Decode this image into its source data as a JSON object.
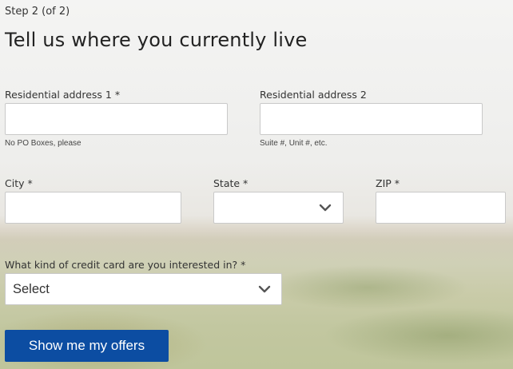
{
  "step": "Step 2 (of 2)",
  "title": "Tell us where you currently live",
  "fields": {
    "address1": {
      "label": "Residential address 1 *",
      "value": "",
      "hint": "No PO Boxes, please"
    },
    "address2": {
      "label": "Residential address 2",
      "value": "",
      "hint": "Suite #, Unit #, etc."
    },
    "city": {
      "label": "City *",
      "value": ""
    },
    "state": {
      "label": "State *",
      "selected": ""
    },
    "zip": {
      "label": "ZIP *",
      "value": ""
    },
    "card_type": {
      "label": "What kind of credit card are you interested in? *",
      "selected": "Select"
    }
  },
  "submit_label": "Show me my offers",
  "colors": {
    "button": "#0c4da2",
    "button_text": "#ffffff"
  },
  "icons": {
    "dropdown": "chevron-down-icon"
  }
}
